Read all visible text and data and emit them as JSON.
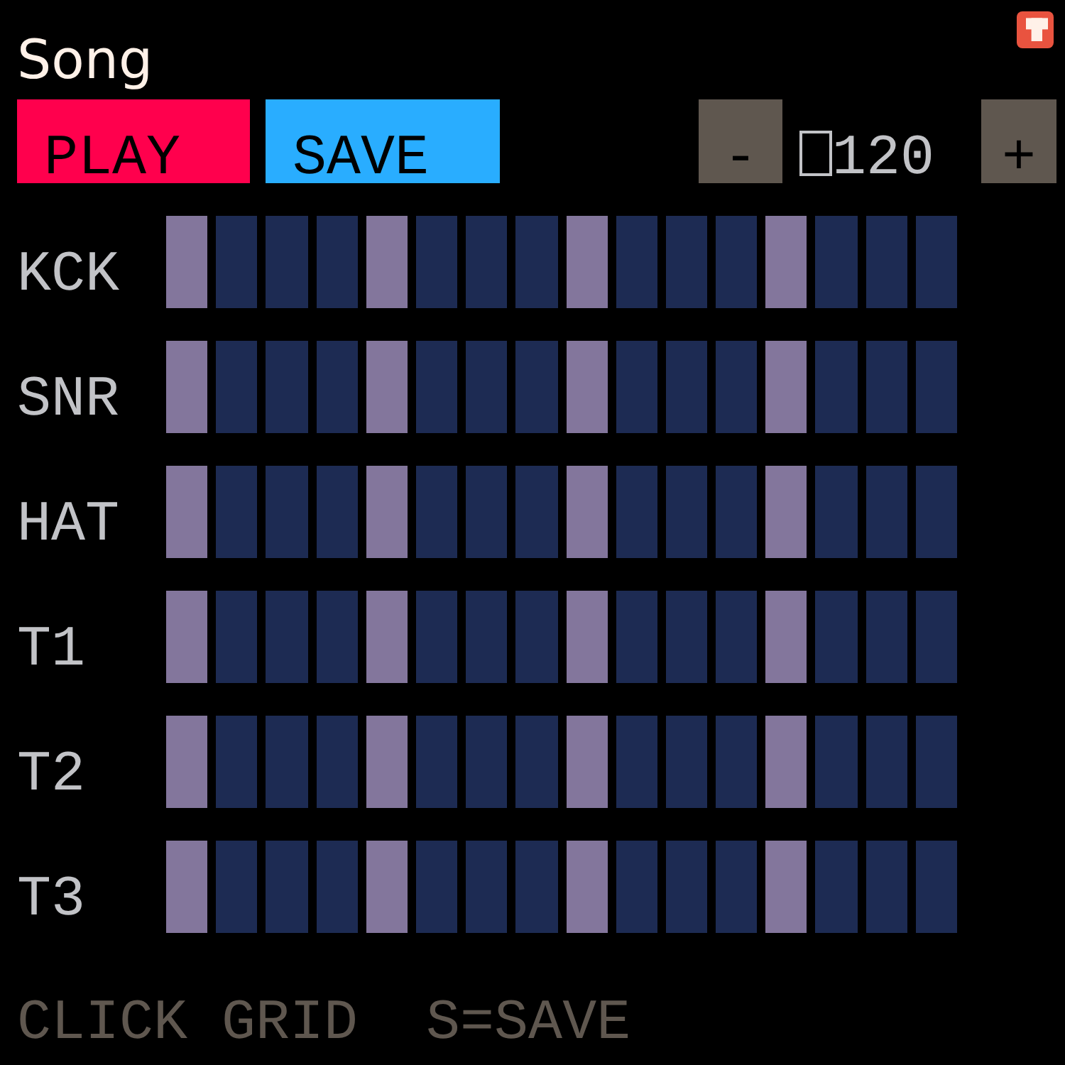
{
  "title": "Song",
  "toolbar": {
    "buttons": [
      {
        "label": "PLAY",
        "color": "#ff004d"
      },
      {
        "label": "SAVE",
        "color": "#29adff"
      }
    ],
    "tempo": {
      "decrease": "-",
      "value": "120",
      "increase": "+"
    }
  },
  "tracks": [
    {
      "name": "KCK",
      "steps": [
        {
          "beat": true
        },
        {
          "beat": false
        },
        {
          "beat": false
        },
        {
          "beat": false
        },
        {
          "beat": true
        },
        {
          "beat": false
        },
        {
          "beat": false
        },
        {
          "beat": false
        },
        {
          "beat": true
        },
        {
          "beat": false
        },
        {
          "beat": false
        },
        {
          "beat": false
        },
        {
          "beat": true
        },
        {
          "beat": false
        },
        {
          "beat": false
        },
        {
          "beat": false
        }
      ]
    },
    {
      "name": "SNR",
      "steps": [
        {
          "beat": true
        },
        {
          "beat": false
        },
        {
          "beat": false
        },
        {
          "beat": false
        },
        {
          "beat": true
        },
        {
          "beat": false
        },
        {
          "beat": false
        },
        {
          "beat": false
        },
        {
          "beat": true
        },
        {
          "beat": false
        },
        {
          "beat": false
        },
        {
          "beat": false
        },
        {
          "beat": true
        },
        {
          "beat": false
        },
        {
          "beat": false
        },
        {
          "beat": false
        }
      ]
    },
    {
      "name": "HAT",
      "steps": [
        {
          "beat": true
        },
        {
          "beat": false
        },
        {
          "beat": false
        },
        {
          "beat": false
        },
        {
          "beat": true
        },
        {
          "beat": false
        },
        {
          "beat": false
        },
        {
          "beat": false
        },
        {
          "beat": true
        },
        {
          "beat": false
        },
        {
          "beat": false
        },
        {
          "beat": false
        },
        {
          "beat": true
        },
        {
          "beat": false
        },
        {
          "beat": false
        },
        {
          "beat": false
        }
      ]
    },
    {
      "name": "T1",
      "steps": [
        {
          "beat": true
        },
        {
          "beat": false
        },
        {
          "beat": false
        },
        {
          "beat": false
        },
        {
          "beat": true
        },
        {
          "beat": false
        },
        {
          "beat": false
        },
        {
          "beat": false
        },
        {
          "beat": true
        },
        {
          "beat": false
        },
        {
          "beat": false
        },
        {
          "beat": false
        },
        {
          "beat": true
        },
        {
          "beat": false
        },
        {
          "beat": false
        },
        {
          "beat": false
        }
      ]
    },
    {
      "name": "T2",
      "steps": [
        {
          "beat": true
        },
        {
          "beat": false
        },
        {
          "beat": false
        },
        {
          "beat": false
        },
        {
          "beat": true
        },
        {
          "beat": false
        },
        {
          "beat": false
        },
        {
          "beat": false
        },
        {
          "beat": true
        },
        {
          "beat": false
        },
        {
          "beat": false
        },
        {
          "beat": false
        },
        {
          "beat": true
        },
        {
          "beat": false
        },
        {
          "beat": false
        },
        {
          "beat": false
        }
      ]
    },
    {
      "name": "T3",
      "steps": [
        {
          "beat": true
        },
        {
          "beat": false
        },
        {
          "beat": false
        },
        {
          "beat": false
        },
        {
          "beat": true
        },
        {
          "beat": false
        },
        {
          "beat": false
        },
        {
          "beat": false
        },
        {
          "beat": true
        },
        {
          "beat": false
        },
        {
          "beat": false
        },
        {
          "beat": false
        },
        {
          "beat": true
        },
        {
          "beat": false
        },
        {
          "beat": false
        },
        {
          "beat": false
        }
      ]
    }
  ],
  "hint": "CLICK GRID  S=SAVE"
}
